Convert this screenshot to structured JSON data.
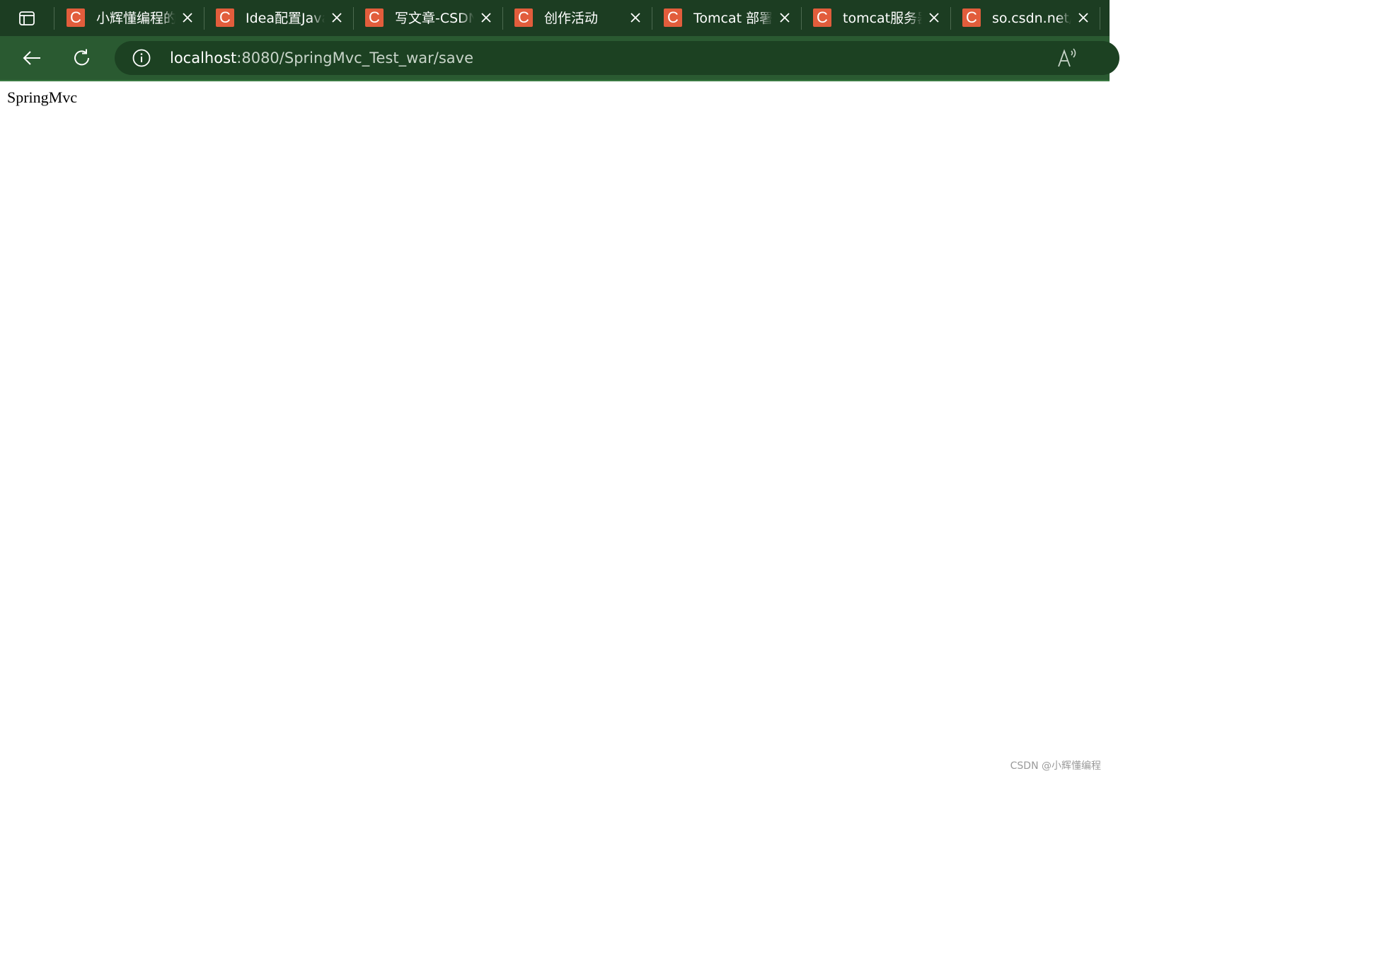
{
  "tabs": [
    {
      "title": "小辉懂编程的",
      "favicon": "C"
    },
    {
      "title": "Idea配置Java",
      "favicon": "C"
    },
    {
      "title": "写文章-CSDN",
      "favicon": "C"
    },
    {
      "title": "创作活动",
      "favicon": "C"
    },
    {
      "title": "Tomcat 部署",
      "favicon": "C"
    },
    {
      "title": "tomcat服务器",
      "favicon": "C"
    },
    {
      "title": "so.csdn.net/s",
      "favicon": "C"
    }
  ],
  "address_bar": {
    "host": "localhost",
    "path": ":8080/SpringMvc_Test_war/save"
  },
  "page": {
    "body_text": "SpringMvc"
  },
  "watermark": "CSDN @小辉懂编程",
  "colors": {
    "tabstrip_bg": "#1c3d22",
    "toolbar_bg": "#2a5a31",
    "favicon_bg": "#e25d3c"
  },
  "icons": {
    "tab_actions": "tab-actions-icon",
    "close": "close-icon",
    "back": "back-arrow-icon",
    "refresh": "refresh-icon",
    "info": "info-icon",
    "read_aloud": "read-aloud-icon"
  }
}
